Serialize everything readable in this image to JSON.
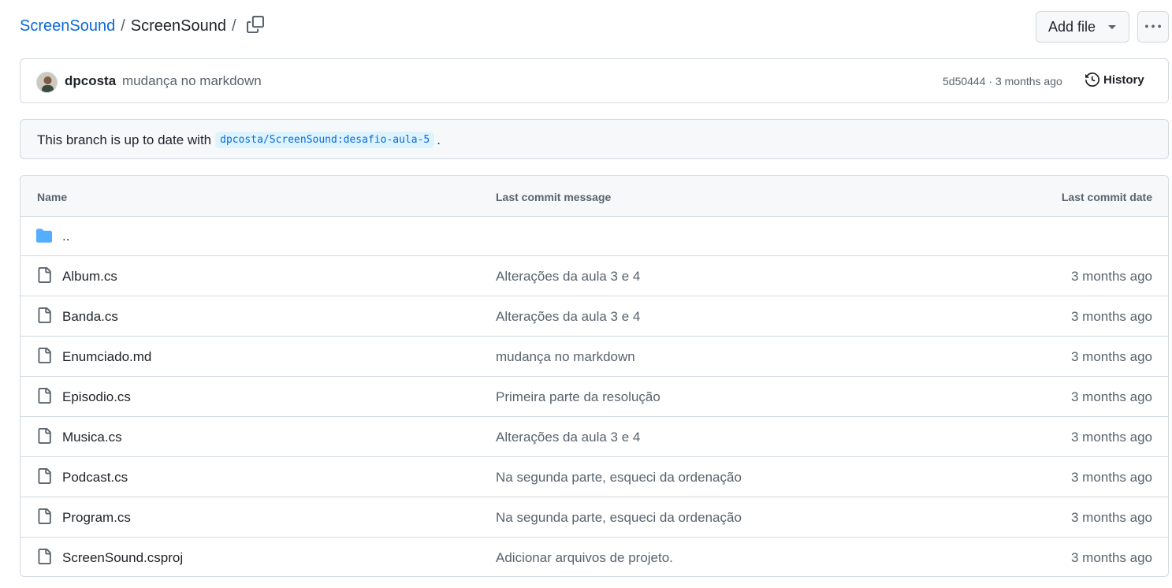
{
  "breadcrumb": {
    "repo_link": "ScreenSound",
    "separator": "/",
    "current": "ScreenSound",
    "trailing_separator": "/"
  },
  "actions": {
    "add_file_label": "Add file",
    "more_icon": "kebab-horizontal-icon",
    "copy_icon": "copy-icon"
  },
  "commit": {
    "author": "dpcosta",
    "message": "mudança no markdown",
    "meta": "5d50444 · 3 months ago",
    "history_label": "History"
  },
  "branch": {
    "prefix": "This branch is up to date with",
    "ref": "dpcosta/ScreenSound:desafio-aula-5",
    "suffix": "."
  },
  "table": {
    "headers": {
      "name": "Name",
      "message": "Last commit message",
      "date": "Last commit date"
    },
    "parent_dir": "..",
    "rows": [
      {
        "name": "Album.cs",
        "message": "Alterações da aula 3 e 4",
        "date": "3 months ago"
      },
      {
        "name": "Banda.cs",
        "message": "Alterações da aula 3 e 4",
        "date": "3 months ago"
      },
      {
        "name": "Enumciado.md",
        "message": "mudança no markdown",
        "date": "3 months ago"
      },
      {
        "name": "Episodio.cs",
        "message": "Primeira parte da resolução",
        "date": "3 months ago"
      },
      {
        "name": "Musica.cs",
        "message": "Alterações da aula 3 e 4",
        "date": "3 months ago"
      },
      {
        "name": "Podcast.cs",
        "message": "Na segunda parte, esqueci da ordenação",
        "date": "3 months ago"
      },
      {
        "name": "Program.cs",
        "message": "Na segunda parte, esqueci da ordenação",
        "date": "3 months ago"
      },
      {
        "name": "ScreenSound.csproj",
        "message": "Adicionar arquivos de projeto.",
        "date": "3 months ago"
      }
    ]
  },
  "colors": {
    "link": "#0969da",
    "muted": "#59636e",
    "border": "#d1d9e0",
    "folder": "#54aeff"
  }
}
